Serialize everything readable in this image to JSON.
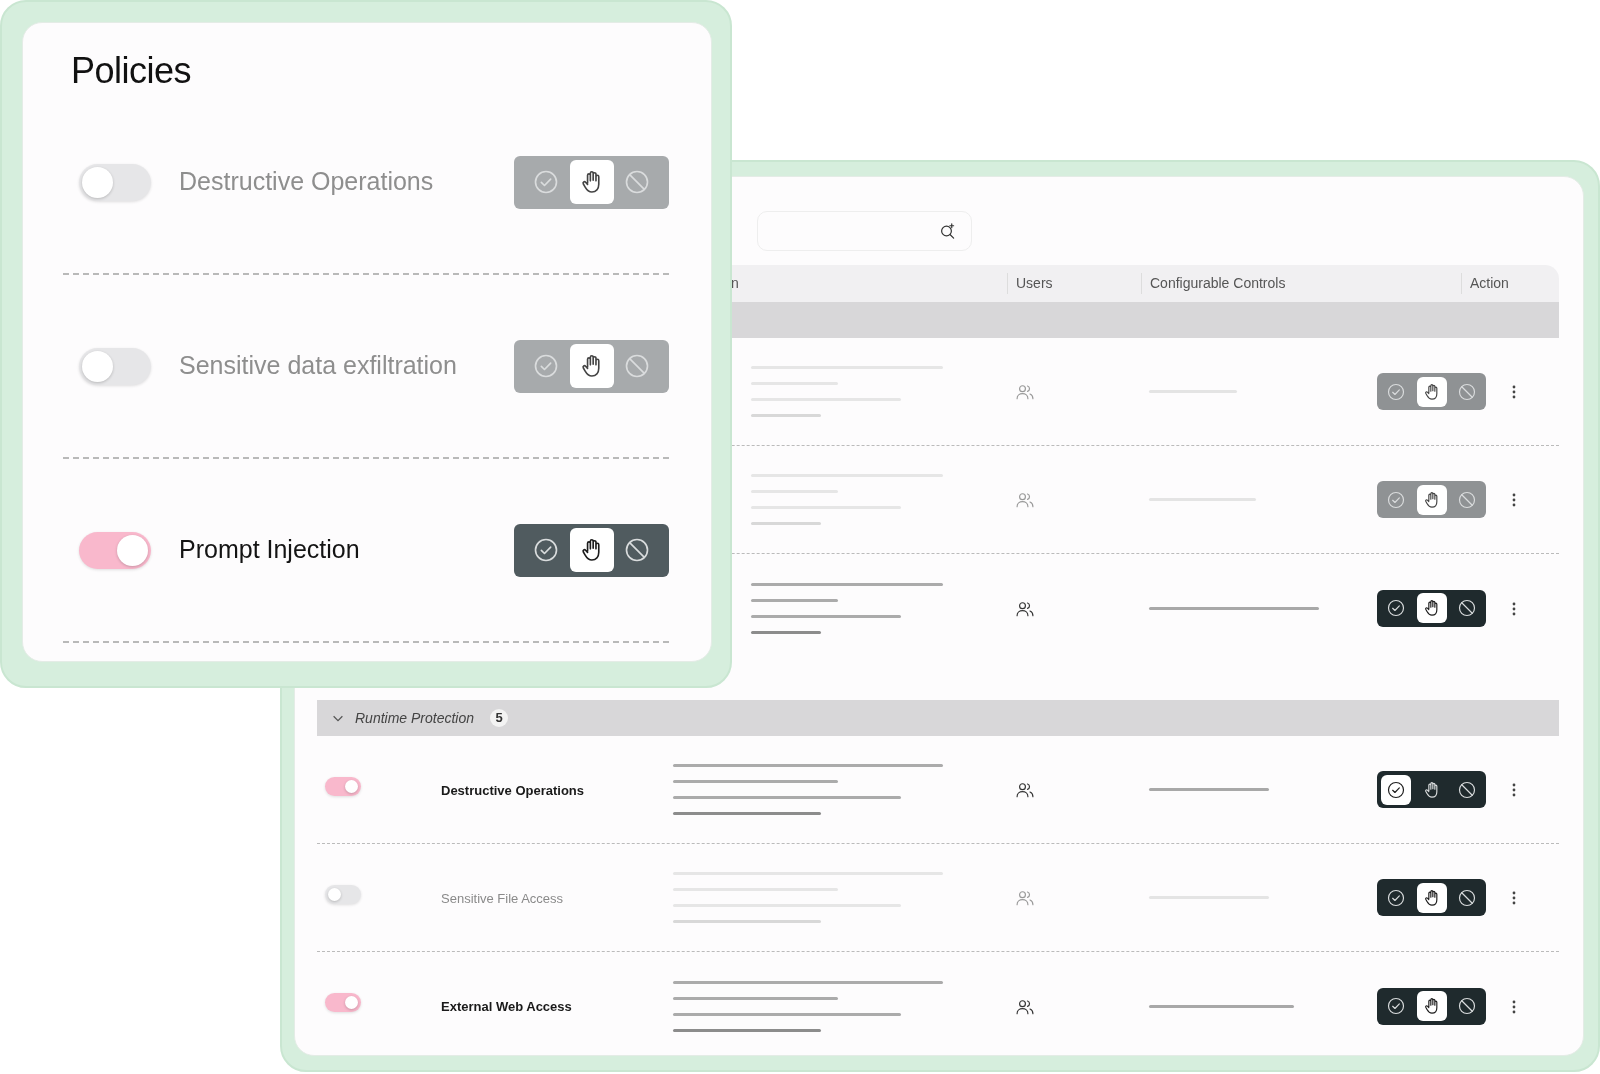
{
  "policies_card": {
    "title": "Policies",
    "policies": [
      {
        "name": "Destructive Operations",
        "on": false,
        "actions": [
          {
            "kind": "allow",
            "selected": false
          },
          {
            "kind": "hold",
            "selected": true
          },
          {
            "kind": "block",
            "selected": false
          }
        ]
      },
      {
        "name": "Sensitive data exfiltration",
        "on": false,
        "actions": [
          {
            "kind": "allow",
            "selected": false
          },
          {
            "kind": "hold",
            "selected": true
          },
          {
            "kind": "block",
            "selected": false
          }
        ]
      },
      {
        "name": "Prompt Injection",
        "on": true,
        "actions": [
          {
            "kind": "allow",
            "selected": false
          },
          {
            "kind": "hold",
            "selected": true
          },
          {
            "kind": "block",
            "selected": false
          }
        ]
      }
    ]
  },
  "policies_table": {
    "columns": [
      "n",
      "Users",
      "Configurable Controls",
      "Action"
    ],
    "groups": [
      {
        "rows": [
          {
            "on": false,
            "actions": [
              {
                "kind": "allow",
                "selected": false
              },
              {
                "kind": "hold",
                "selected": true
              },
              {
                "kind": "block",
                "selected": false
              }
            ]
          },
          {
            "on": false,
            "actions": [
              {
                "kind": "allow",
                "selected": false
              },
              {
                "kind": "hold",
                "selected": true
              },
              {
                "kind": "block",
                "selected": false
              }
            ]
          },
          {
            "on": true,
            "actions": [
              {
                "kind": "allow",
                "selected": false
              },
              {
                "kind": "hold",
                "selected": true
              },
              {
                "kind": "block",
                "selected": false
              }
            ]
          }
        ]
      },
      {
        "label": "Runtime Protection",
        "count": "5",
        "expanded": true,
        "rows": [
          {
            "name": "Destructive Operations",
            "on": true,
            "actions": [
              {
                "kind": "allow",
                "selected": true
              },
              {
                "kind": "hold",
                "selected": false
              },
              {
                "kind": "block",
                "selected": false
              }
            ]
          },
          {
            "name": "Sensitive File Access",
            "on": false,
            "selector_enabled": true,
            "actions": [
              {
                "kind": "allow",
                "selected": false
              },
              {
                "kind": "hold",
                "selected": true
              },
              {
                "kind": "block",
                "selected": false
              }
            ]
          },
          {
            "name": "External Web Access",
            "on": true,
            "actions": [
              {
                "kind": "allow",
                "selected": false
              },
              {
                "kind": "hold",
                "selected": true
              },
              {
                "kind": "block",
                "selected": false
              }
            ]
          }
        ]
      }
    ]
  }
}
